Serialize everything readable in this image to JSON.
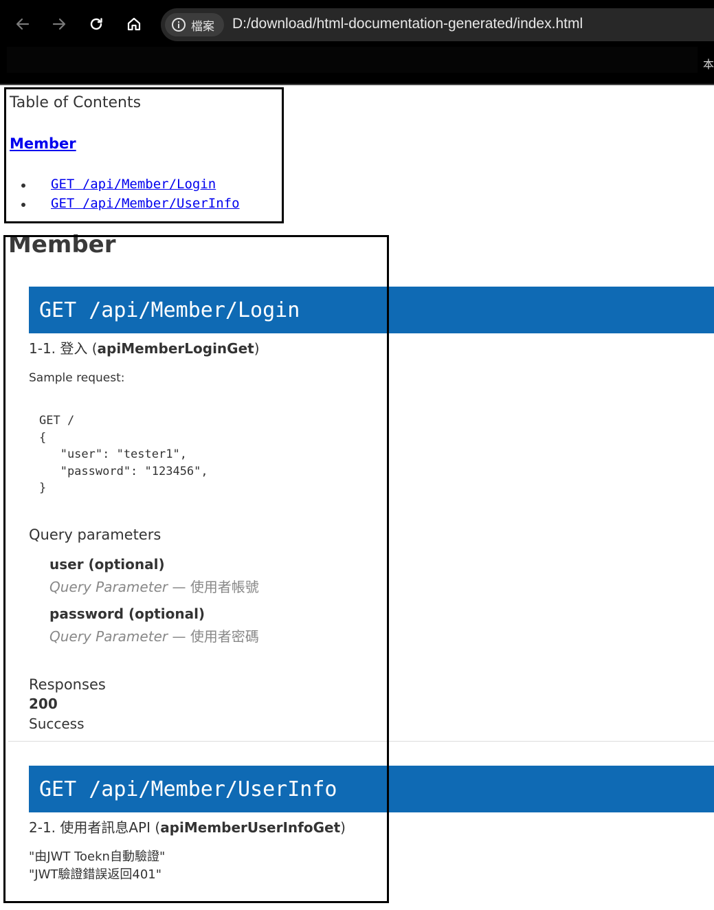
{
  "browser": {
    "url": "D:/download/html-documentation-generated/index.html",
    "site_label": "檔案",
    "bookmarks_overflow": "本"
  },
  "toc": {
    "title": "Table of Contents",
    "group": "Member",
    "links": [
      "GET /api/Member/Login",
      "GET /api/Member/UserInfo"
    ]
  },
  "section": {
    "heading": "Member",
    "endpoints": [
      {
        "bar": "GET /api/Member/Login",
        "title_prefix": "1-1. 登入 (",
        "operation_id": "apiMemberLoginGet",
        "title_suffix": ")",
        "sample_label": "Sample request:",
        "sample_code": "GET /\n{\n   \"user\": \"tester1\",\n   \"password\": \"123456\",\n}",
        "params_heading": "Query parameters",
        "params": [
          {
            "name": "user (optional)",
            "type": "Query Parameter",
            "sep": " — ",
            "desc": "使用者帳號"
          },
          {
            "name": "password (optional)",
            "type": "Query Parameter",
            "sep": " — ",
            "desc": "使用者密碼"
          }
        ],
        "responses_heading": "Responses",
        "response_code": "200",
        "response_desc": "Success"
      },
      {
        "bar": "GET /api/Member/UserInfo",
        "title_prefix": "2-1. 使用者訊息API (",
        "operation_id": "apiMemberUserInfoGet",
        "title_suffix": ")",
        "notes": [
          "\"由JWT Toekn自動驗證\"",
          "\"JWT驗證錯誤返回401\""
        ]
      }
    ]
  }
}
